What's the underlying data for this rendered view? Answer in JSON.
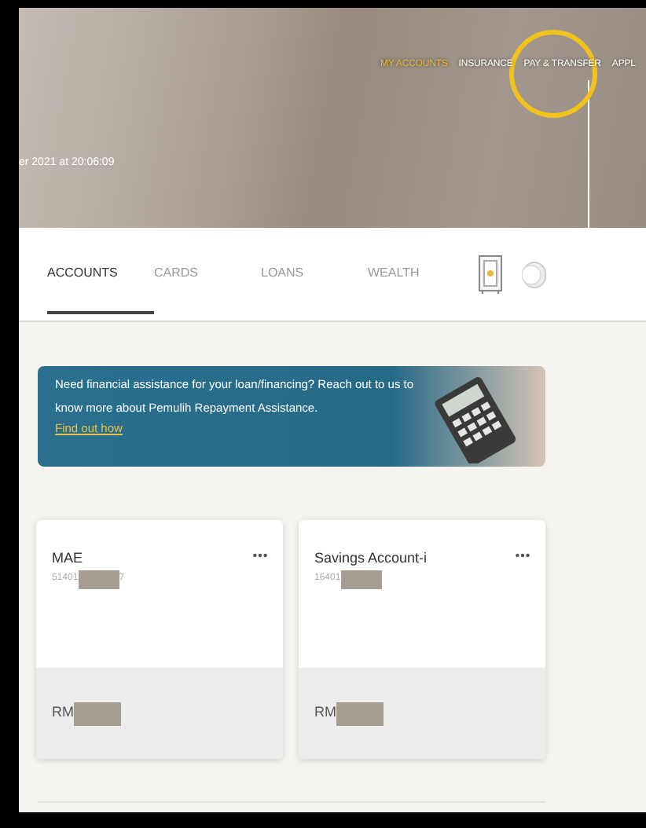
{
  "top_nav": [
    {
      "label": "MY ACCOUNTS",
      "selected": true
    },
    {
      "label": "INSURANCE",
      "selected": false
    },
    {
      "label": "PAY & TRANSFER",
      "selected": false
    },
    {
      "label": "APPL",
      "selected": false
    }
  ],
  "last_login": "er 2021 at 20:06:09",
  "tabs": [
    {
      "label": "ACCOUNTS",
      "selected": true
    },
    {
      "label": "CARDS",
      "selected": false
    },
    {
      "label": "LOANS",
      "selected": false
    },
    {
      "label": "WEALTH",
      "selected": false
    }
  ],
  "banner": {
    "text": "Need financial assistance for your loan/financing? Reach out to us to know more about Pemulih Repayment Assistance.",
    "link": "Find out how"
  },
  "accounts": [
    {
      "name": "MAE",
      "number": "51401",
      "number_end": "7",
      "balance": "RM"
    },
    {
      "name": "Savings Account-i",
      "number": "16401",
      "balance": "RM"
    }
  ]
}
